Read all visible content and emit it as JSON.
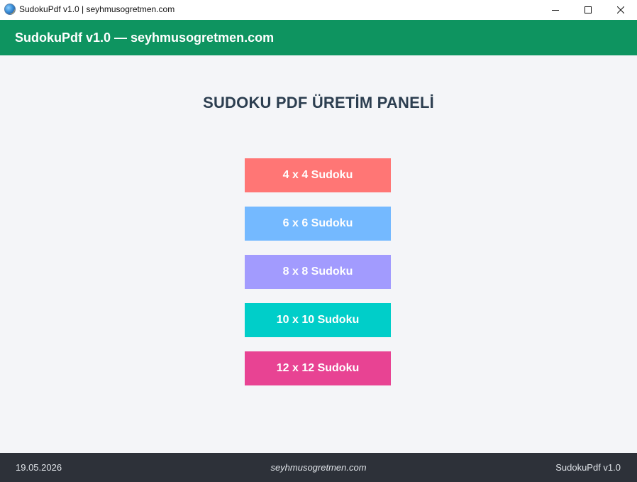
{
  "window": {
    "title": "SudokuPdf v1.0 | seyhmusogretmen.com",
    "icon": "globe-icon",
    "controls": [
      "minimize-icon",
      "maximize-icon",
      "close-icon"
    ]
  },
  "header": {
    "title": "SudokuPdf v1.0 — seyhmusogretmen.com",
    "color": "#0e9460"
  },
  "main": {
    "title": "SUDOKU PDF ÜRETİM PANELİ",
    "buttons": [
      {
        "label": "4 x 4 Sudoku",
        "color": "#ff7675"
      },
      {
        "label": "6 x 6 Sudoku",
        "color": "#74b9ff"
      },
      {
        "label": "8 x 8 Sudoku",
        "color": "#a29bfe"
      },
      {
        "label": "10 x 10 Sudoku",
        "color": "#00cec9"
      },
      {
        "label": "12 x 12 Sudoku",
        "color": "#e84393"
      }
    ]
  },
  "footer": {
    "date": "19.05.2026",
    "site": "seyhmusogretmen.com",
    "version": "SudokuPdf v1.0"
  }
}
